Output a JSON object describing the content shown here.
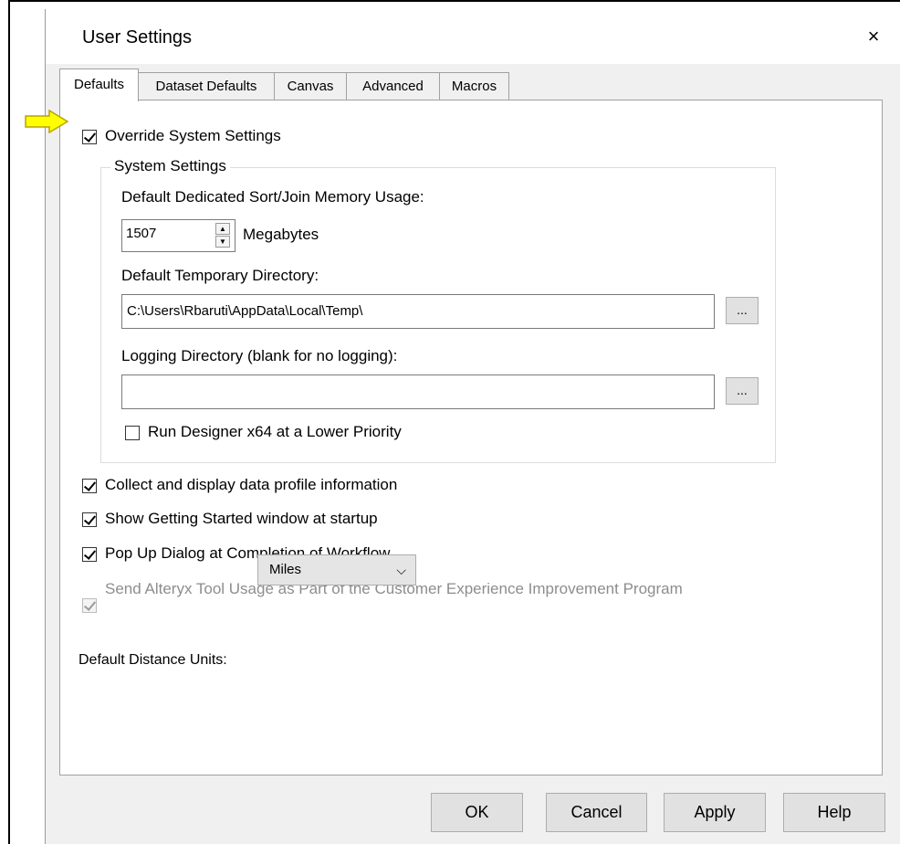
{
  "dialog": {
    "title": "User Settings",
    "close_label": "×"
  },
  "tabs": [
    {
      "label": "Defaults",
      "active": true
    },
    {
      "label": "Dataset Defaults",
      "active": false
    },
    {
      "label": "Canvas",
      "active": false
    },
    {
      "label": "Advanced",
      "active": false
    },
    {
      "label": "Macros",
      "active": false
    }
  ],
  "override": {
    "label": "Override System Settings",
    "checked": true,
    "annotation_arrow_color": "#ffff00"
  },
  "system_settings": {
    "group_title": "System Settings",
    "memory_label": "Default Dedicated Sort/Join Memory Usage:",
    "memory_value": "1507",
    "memory_unit": "Megabytes",
    "temp_dir_label": "Default Temporary Directory:",
    "temp_dir_value": "C:\\Users\\Rbaruti\\AppData\\Local\\Temp\\",
    "log_dir_label": "Logging Directory (blank for no logging):",
    "log_dir_value": "",
    "browse_label": "...",
    "lower_priority": {
      "label": "Run Designer x64 at a Lower Priority",
      "checked": false
    }
  },
  "options": [
    {
      "label": "Collect and display data profile information",
      "checked": true
    },
    {
      "label": "Show Getting Started window at startup",
      "checked": true
    },
    {
      "label": "Pop Up Dialog at Completion of Workflow",
      "checked": true
    }
  ],
  "telemetry": {
    "label": "Send Alteryx Tool Usage as Part of the Customer Experience Improvement Program",
    "checked": true,
    "disabled": true
  },
  "distance_units": {
    "label": "Default Distance Units:",
    "value": "Miles"
  },
  "buttons": {
    "ok": "OK",
    "cancel": "Cancel",
    "apply": "Apply",
    "help": "Help"
  }
}
